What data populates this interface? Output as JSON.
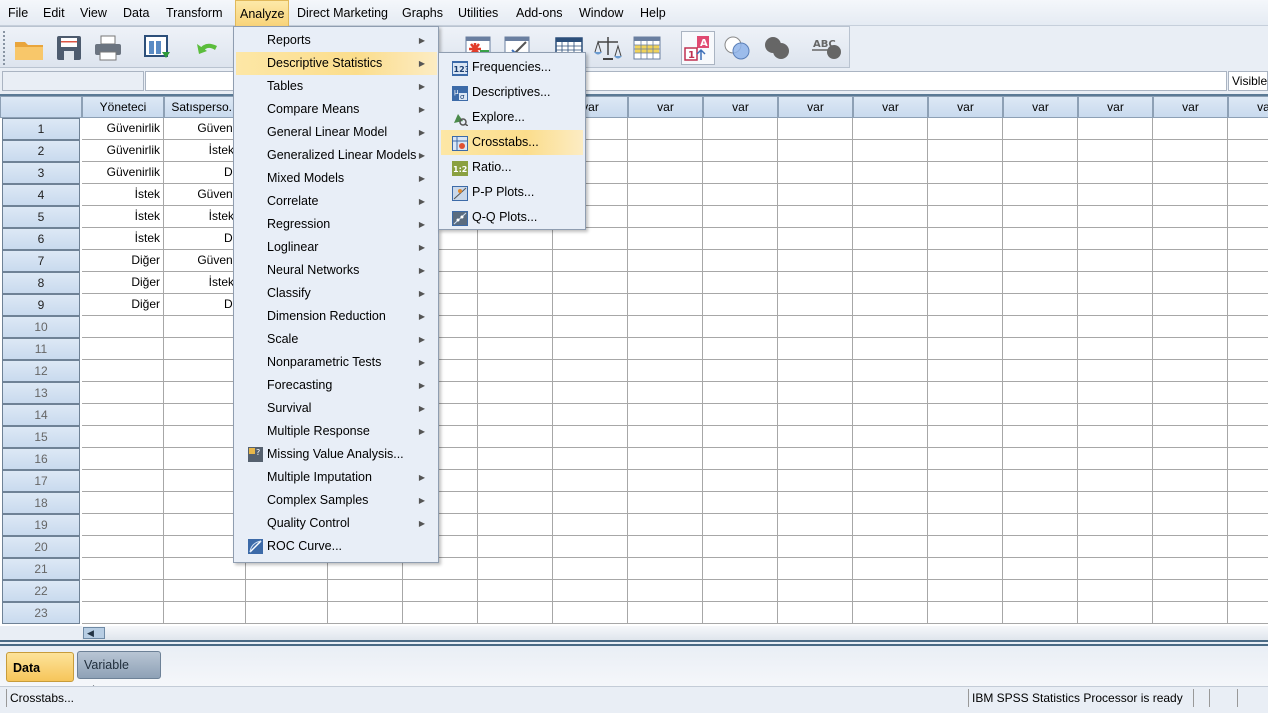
{
  "menubar": {
    "items": [
      "File",
      "Edit",
      "View",
      "Data",
      "Transform",
      "Analyze",
      "Direct Marketing",
      "Graphs",
      "Utilities",
      "Add-ons",
      "Window",
      "Help"
    ],
    "active": "Analyze"
  },
  "toolbar": {
    "icons": [
      "open-folder-icon",
      "save-icon",
      "print-icon",
      "recall-dialog-icon",
      "undo-icon",
      "insert-cases-icon",
      "insert-variable-icon",
      "split-file-icon",
      "weight-cases-icon",
      "select-cases-icon",
      "value-labels-icon",
      "use-variable-sets-icon",
      "show-all-variables-icon",
      "spell-check-icon"
    ]
  },
  "cellbar": {
    "cell_ref": "",
    "cell_value": "",
    "visible_label": "Visible"
  },
  "grid": {
    "columns": [
      "Yöneteci",
      "Satısperso...",
      "var",
      "var",
      "var",
      "var",
      "var",
      "var",
      "var",
      "var",
      "var",
      "var",
      "var",
      "var",
      "var",
      "var"
    ],
    "rows": [
      {
        "n": "1",
        "cells": [
          "Güvenirlik",
          "Güvenirl"
        ]
      },
      {
        "n": "2",
        "cells": [
          "Güvenirlik",
          "İsteklil"
        ]
      },
      {
        "n": "3",
        "cells": [
          "Güvenirlik",
          "Diğ"
        ]
      },
      {
        "n": "4",
        "cells": [
          "İstek",
          "Güvenirl"
        ]
      },
      {
        "n": "5",
        "cells": [
          "İstek",
          "İsteklil"
        ]
      },
      {
        "n": "6",
        "cells": [
          "İstek",
          "Diğ"
        ]
      },
      {
        "n": "7",
        "cells": [
          "Diğer",
          "Güvenirl"
        ]
      },
      {
        "n": "8",
        "cells": [
          "Diğer",
          "İsteklil"
        ]
      },
      {
        "n": "9",
        "cells": [
          "Diğer",
          "Diğ"
        ]
      },
      {
        "n": "10",
        "cells": []
      },
      {
        "n": "11",
        "cells": []
      },
      {
        "n": "12",
        "cells": []
      },
      {
        "n": "13",
        "cells": []
      },
      {
        "n": "14",
        "cells": []
      },
      {
        "n": "15",
        "cells": []
      },
      {
        "n": "16",
        "cells": []
      },
      {
        "n": "17",
        "cells": []
      },
      {
        "n": "18",
        "cells": []
      },
      {
        "n": "19",
        "cells": []
      },
      {
        "n": "20",
        "cells": []
      },
      {
        "n": "21",
        "cells": []
      },
      {
        "n": "22",
        "cells": []
      },
      {
        "n": "23",
        "cells": []
      }
    ]
  },
  "analyze_menu": {
    "items": [
      {
        "label": "Reports",
        "submenu": true
      },
      {
        "label": "Descriptive Statistics",
        "submenu": true,
        "highlighted": true
      },
      {
        "label": "Tables",
        "submenu": true
      },
      {
        "label": "Compare Means",
        "submenu": true
      },
      {
        "label": "General Linear Model",
        "submenu": true
      },
      {
        "label": "Generalized Linear Models",
        "submenu": true
      },
      {
        "label": "Mixed Models",
        "submenu": true
      },
      {
        "label": "Correlate",
        "submenu": true
      },
      {
        "label": "Regression",
        "submenu": true
      },
      {
        "label": "Loglinear",
        "submenu": true
      },
      {
        "label": "Neural Networks",
        "submenu": true
      },
      {
        "label": "Classify",
        "submenu": true
      },
      {
        "label": "Dimension Reduction",
        "submenu": true
      },
      {
        "label": "Scale",
        "submenu": true
      },
      {
        "label": "Nonparametric Tests",
        "submenu": true
      },
      {
        "label": "Forecasting",
        "submenu": true
      },
      {
        "label": "Survival",
        "submenu": true
      },
      {
        "label": "Multiple Response",
        "submenu": true
      },
      {
        "label": "Missing Value Analysis...",
        "submenu": false,
        "icon": "missing-value-icon"
      },
      {
        "label": "Multiple Imputation",
        "submenu": true
      },
      {
        "label": "Complex Samples",
        "submenu": true
      },
      {
        "label": "Quality Control",
        "submenu": true
      },
      {
        "label": "ROC Curve...",
        "submenu": false,
        "icon": "roc-curve-icon"
      }
    ]
  },
  "descriptive_submenu": {
    "items": [
      {
        "label": "Frequencies...",
        "icon": "frequencies-icon"
      },
      {
        "label": "Descriptives...",
        "icon": "descriptives-icon"
      },
      {
        "label": "Explore...",
        "icon": "explore-icon"
      },
      {
        "label": "Crosstabs...",
        "icon": "crosstabs-icon",
        "highlighted": true
      },
      {
        "label": "Ratio...",
        "icon": "ratio-icon"
      },
      {
        "label": "P-P Plots...",
        "icon": "pp-plots-icon"
      },
      {
        "label": "Q-Q Plots...",
        "icon": "qq-plots-icon"
      }
    ]
  },
  "view_tabs": {
    "data_view": "Data View",
    "variable_view": "Variable View",
    "active": "Data View"
  },
  "statusbar": {
    "message": "Crosstabs...",
    "processor": "IBM SPSS Statistics Processor is ready"
  },
  "colors": {
    "highlight": "#fbdd8c",
    "header_blue": "#c9daee",
    "menu_bg": "#e8eef7"
  }
}
